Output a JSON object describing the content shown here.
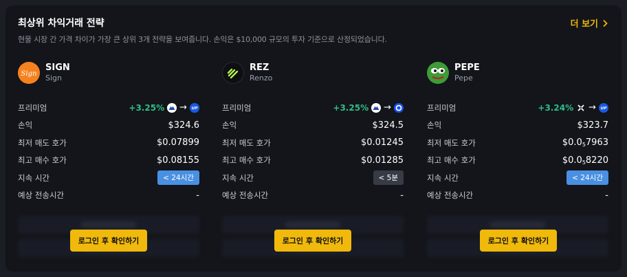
{
  "header": {
    "title": "최상위 차익거래 전략",
    "subtitle": "현물 시장 간 가격 차이가 가장 큰 상위 3개 전략을 보여줍니다. 손익은 $10,000 규모의 투자 기준으로 산정되었습니다.",
    "more_label": "더 보기"
  },
  "labels": {
    "premium": "프리미엄",
    "pnl": "손익",
    "lowest_ask": "최저 매도 호가",
    "highest_bid": "최고 매수 호가",
    "duration": "지속 시간",
    "transfer_time": "예상 전송시간",
    "login_button": "로그인 후 확인하기"
  },
  "colors": {
    "accent": "#f0b90b",
    "positive": "#2ebd85",
    "badge_blue": "#4a90e2",
    "badge_gray": "#363b45"
  },
  "strategies": [
    {
      "symbol": "SIGN",
      "name": "Sign",
      "premium": "+3.25%",
      "from_exchange_icon": "mountain-exchange-icon",
      "to_exchange_icon": "up-exchange-icon",
      "pnl": "$324.6",
      "lowest_ask": "$0.07899",
      "highest_bid": "$0.08155",
      "duration": "< 24시간",
      "transfer_time": "-"
    },
    {
      "symbol": "REZ",
      "name": "Renzo",
      "premium": "+3.25%",
      "from_exchange_icon": "mountain-exchange-icon",
      "to_exchange_icon": "coinbase-exchange-icon",
      "pnl": "$324.5",
      "lowest_ask": "$0.01245",
      "highest_bid": "$0.01285",
      "duration": "< 5분",
      "transfer_time": "-"
    },
    {
      "symbol": "PEPE",
      "name": "Pepe",
      "premium": "+3.24%",
      "from_exchange_icon": "x-exchange-icon",
      "to_exchange_icon": "up-exchange-icon",
      "pnl": "$323.7",
      "lowest_ask_prefix": "$0.0",
      "lowest_ask_sub": "5",
      "lowest_ask_rest": "7963",
      "highest_bid_prefix": "$0.0",
      "highest_bid_sub": "5",
      "highest_bid_rest": "8220",
      "duration": "< 24시간",
      "transfer_time": "-"
    }
  ]
}
